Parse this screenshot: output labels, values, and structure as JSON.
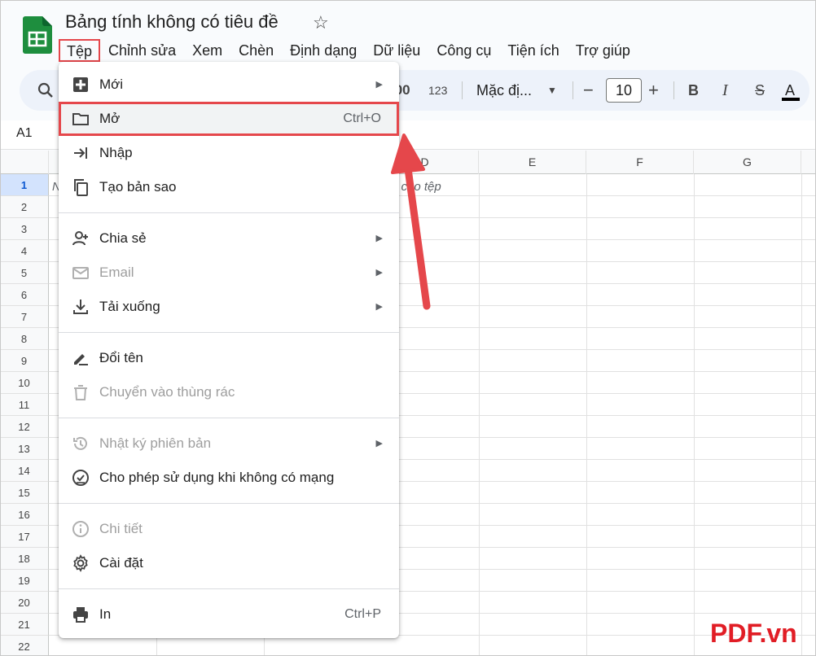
{
  "app": {
    "title": "Bảng tính không có tiêu đề",
    "accent_color": "#e5474b",
    "logo_color": "#1e8e3e"
  },
  "menubar": {
    "items": [
      "Tệp",
      "Chỉnh sửa",
      "Xem",
      "Chèn",
      "Định dạng",
      "Dữ liệu",
      "Công cụ",
      "Tiện ích",
      "Trợ giúp"
    ],
    "active": "Tệp"
  },
  "toolbar": {
    "decimal_label": ".00",
    "number_format_label": "123",
    "font_label": "Mặc đị...",
    "minus": "−",
    "font_size": "10",
    "plus": "+",
    "bold": "B",
    "italic": "I",
    "strike": "S",
    "text_color": "A"
  },
  "formula": {
    "cell_ref": "A1"
  },
  "grid": {
    "columns": [
      "D",
      "E",
      "F",
      "G"
    ],
    "rows": [
      "1",
      "2",
      "3",
      "4",
      "5",
      "6",
      "7",
      "8",
      "9",
      "10",
      "11",
      "12",
      "13",
      "14",
      "15",
      "16",
      "17",
      "18",
      "19",
      "20",
      "21",
      "22"
    ],
    "selected_row": "1",
    "cell_a1_text": "N",
    "cell_d1_text": "n cho tệp"
  },
  "file_menu": {
    "items": [
      {
        "label": "Mới",
        "icon": "new-sheet-icon",
        "submenu": true
      },
      {
        "label": "Mở",
        "icon": "folder-icon",
        "shortcut": "Ctrl+O",
        "highlighted": true
      },
      {
        "label": "Nhập",
        "icon": "import-icon"
      },
      {
        "label": "Tạo bản sao",
        "icon": "copy-icon"
      },
      {
        "label": "Chia sẻ",
        "icon": "share-icon",
        "submenu": true
      },
      {
        "label": "Email",
        "icon": "email-icon",
        "submenu": true,
        "disabled": true
      },
      {
        "label": "Tải xuống",
        "icon": "download-icon",
        "submenu": true
      },
      {
        "label": "Đổi tên",
        "icon": "rename-icon"
      },
      {
        "label": "Chuyển vào thùng rác",
        "icon": "trash-icon",
        "disabled": true
      },
      {
        "label": "Nhật ký phiên bản",
        "icon": "history-icon",
        "submenu": true,
        "disabled": true
      },
      {
        "label": "Cho phép sử dụng khi không có mạng",
        "icon": "offline-icon"
      },
      {
        "label": "Chi tiết",
        "icon": "info-icon",
        "disabled": true
      },
      {
        "label": "Cài đặt",
        "icon": "gear-icon"
      },
      {
        "label": "In",
        "icon": "print-icon",
        "shortcut": "Ctrl+P"
      }
    ],
    "submenu_arrow": "▶"
  },
  "watermark": "PDF.vn"
}
